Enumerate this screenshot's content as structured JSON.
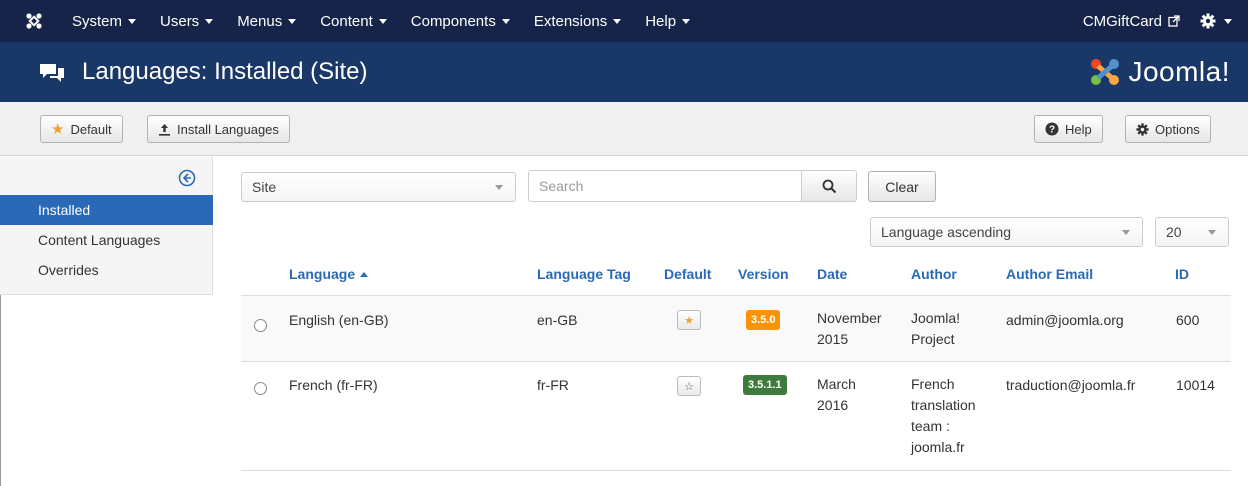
{
  "topnav": {
    "menu": [
      {
        "label": "System"
      },
      {
        "label": "Users"
      },
      {
        "label": "Menus"
      },
      {
        "label": "Content"
      },
      {
        "label": "Components"
      },
      {
        "label": "Extensions"
      },
      {
        "label": "Help"
      }
    ],
    "site_name": "CMGiftCard"
  },
  "header": {
    "title": "Languages: Installed (Site)",
    "brand": "Joomla!"
  },
  "toolbar": {
    "default_label": "Default",
    "install_label": "Install Languages",
    "help_label": "Help",
    "options_label": "Options"
  },
  "sidebar": {
    "items": [
      {
        "label": "Installed",
        "active": true
      },
      {
        "label": "Content Languages",
        "active": false
      },
      {
        "label": "Overrides",
        "active": false
      }
    ]
  },
  "filters": {
    "client_selected": "Site",
    "search_placeholder": "Search",
    "clear_label": "Clear",
    "ordering_selected": "Language ascending",
    "limit_selected": "20"
  },
  "table": {
    "columns": [
      "Language",
      "Language Tag",
      "Default",
      "Version",
      "Date",
      "Author",
      "Author Email",
      "ID"
    ],
    "rows": [
      {
        "language": "English (en-GB)",
        "tag": "en-GB",
        "default": true,
        "version": "3.5.0",
        "version_color": "#f89406",
        "date": [
          "November",
          "2015"
        ],
        "author": [
          "Joomla!",
          "Project"
        ],
        "email": "admin@joomla.org",
        "id": "600"
      },
      {
        "language": "French (fr-FR)",
        "tag": "fr-FR",
        "default": false,
        "version": "3.5.1.1",
        "version_color": "#3e7a3e",
        "date": [
          "March",
          "2016"
        ],
        "author": [
          "French",
          "translation",
          "team :",
          "joomla.fr"
        ],
        "email": "traduction@joomla.fr",
        "id": "10014"
      }
    ]
  },
  "colors": {
    "topnav_bg": "#152448",
    "header_bg": "#1a3867",
    "accent": "#2a69b8",
    "star": "#f0a030"
  }
}
